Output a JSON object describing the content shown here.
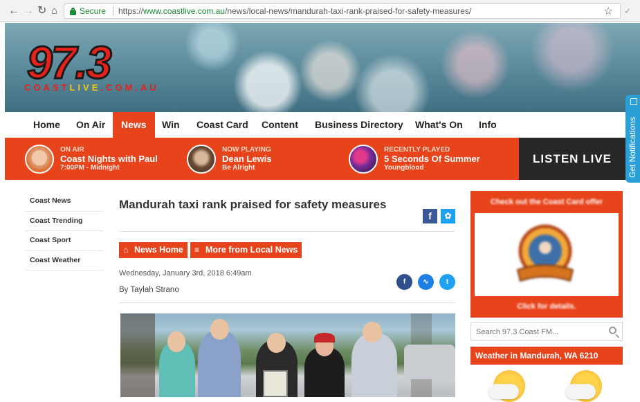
{
  "browser": {
    "secure_label": "Secure",
    "url_scheme": "https://",
    "url_host": "www.coastlive.com.au",
    "url_path": "/news/local-news/mandurah-taxi-rank-praised-for-safety-measures/"
  },
  "logo": {
    "number": "97.3",
    "text_coast": "COAST",
    "text_live": "LIVE",
    "text_domain": ".COM.AU"
  },
  "notification_tab": "Get Notifications",
  "nav": {
    "items": [
      "Home",
      "On Air",
      "News",
      "Win",
      "Coast Card",
      "Content",
      "Business Directory",
      "What's On",
      "Info"
    ],
    "active": "News"
  },
  "infobar": {
    "on_air": {
      "label": "ON AIR",
      "title": "Coast Nights with Paul",
      "sub": "7:00PM - Midnight"
    },
    "now_playing": {
      "label": "NOW PLAYING",
      "title": "Dean Lewis",
      "sub": "Be Alright"
    },
    "recently_played": {
      "label": "RECENTLY PLAYED",
      "title": "5 Seconds Of Summer",
      "sub": "Youngblood"
    },
    "listen_live": "LISTEN LIVE"
  },
  "sidebar": {
    "items": [
      "Coast News",
      "Coast Trending",
      "Coast Sport",
      "Coast Weather"
    ]
  },
  "article": {
    "title": "Mandurah taxi rank praised for safety measures",
    "news_home_label": "News Home",
    "more_label": "More from Local News",
    "date": "Wednesday, January 3rd, 2018 6:49am",
    "byline": "By Taylah Strano"
  },
  "promo": {
    "top_text": "Check out the Coast Card offer",
    "bottom_text": "Click for details."
  },
  "search": {
    "placeholder": "Search 97.3 Coast FM..."
  },
  "weather": {
    "title": "Weather in Mandurah, WA 6210"
  },
  "colors": {
    "accent": "#e8441c",
    "dark": "#272727",
    "facebook": "#3b5998",
    "twitter": "#1da1f2"
  }
}
